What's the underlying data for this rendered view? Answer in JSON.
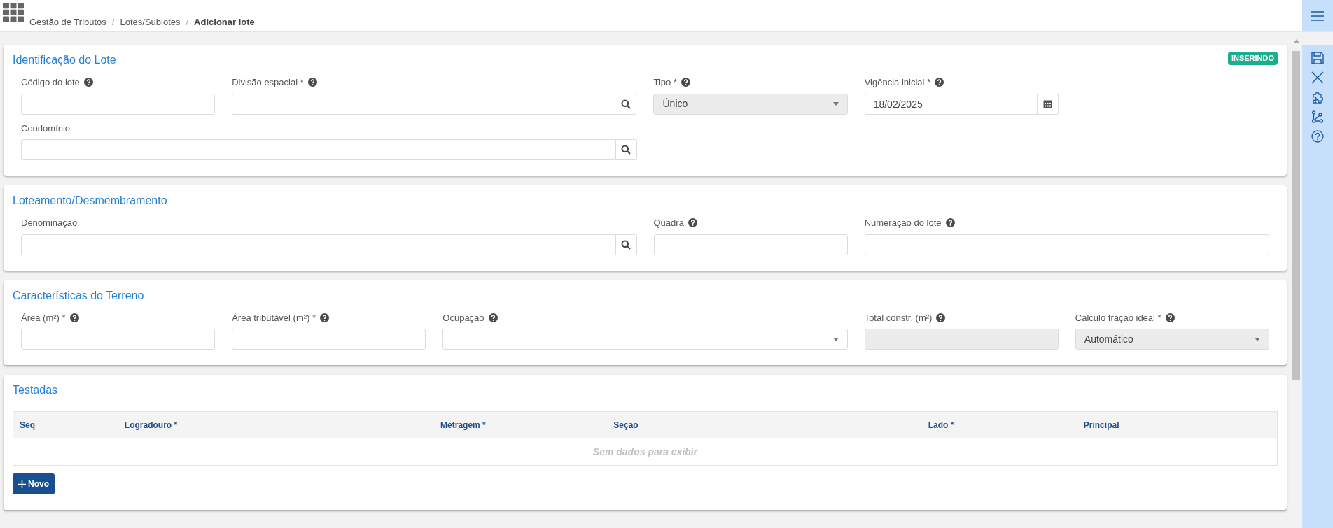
{
  "header": {
    "separator": "/",
    "breadcrumb": [
      {
        "label": "Gestão de Tributos",
        "current": false
      },
      {
        "label": "Lotes/Sublotes",
        "current": false
      },
      {
        "label": "Adicionar lote",
        "current": true
      }
    ]
  },
  "sections": [
    {
      "title": "Identificação do Lote",
      "badge": "INSERINDO",
      "rows": [
        [
          {
            "label": "Código do lote",
            "help": true,
            "kind": "text",
            "disabled": false
          },
          {
            "label": "Divisão espacial *",
            "help": true,
            "kind": "lookup",
            "disabled": false
          },
          {
            "label": "Tipo *",
            "help": true,
            "kind": "select",
            "value": "Único",
            "disabled": true
          },
          {
            "label": "Vigência inicial *",
            "help": true,
            "kind": "date",
            "value": "18/02/2025",
            "disabled": false
          }
        ],
        [
          {
            "label": "Condomínio",
            "help": false,
            "kind": "lookup",
            "disabled": false
          }
        ]
      ]
    },
    {
      "title": "Loteamento/Desmembramento",
      "rows": [
        [
          {
            "label": "Denominação",
            "help": false,
            "kind": "lookup",
            "disabled": false
          },
          {
            "label": "Quadra",
            "help": true,
            "kind": "text",
            "disabled": false
          },
          {
            "label": "Numeração do lote",
            "help": true,
            "kind": "text",
            "disabled": false
          }
        ]
      ]
    },
    {
      "title": "Características do Terreno",
      "rows": [
        [
          {
            "label": "Área (m²) *",
            "help": true,
            "kind": "text",
            "disabled": false
          },
          {
            "label": "Área tributável (m²) *",
            "help": true,
            "kind": "text",
            "disabled": false
          },
          {
            "label": "Ocupação",
            "help": true,
            "kind": "select",
            "disabled": false
          },
          {
            "label": "Total constr. (m²)",
            "help": true,
            "kind": "text",
            "disabled": true
          },
          {
            "label": "Cálculo fração ideal *",
            "help": true,
            "kind": "select",
            "value": "Automático",
            "disabled": true
          }
        ]
      ]
    },
    {
      "title": "Testadas",
      "table": {
        "columns": [
          "Seq",
          "Logradouro *",
          "Metragem *",
          "Seção",
          "Lado *",
          "Principal"
        ],
        "empty_message": "Sem dados para exibir"
      },
      "add_button": "Novo"
    }
  ]
}
